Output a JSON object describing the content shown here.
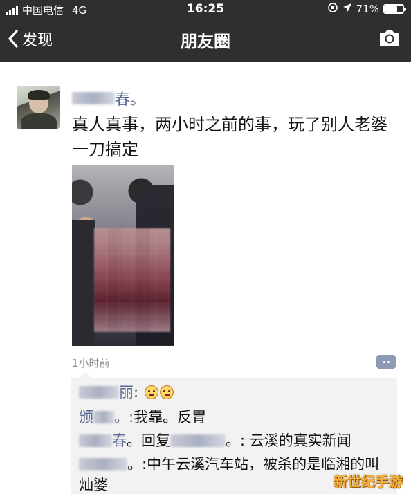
{
  "status_bar": {
    "carrier": "中国电信",
    "network": "4G",
    "time": "16:25",
    "battery": "71%",
    "battery_level": 0.71
  },
  "nav": {
    "back_label": "发现",
    "title": "朋友圈"
  },
  "post": {
    "nickname_visible": "春。",
    "text": "真人真事，两小时之前的事，玩了别人老婆一刀搞定",
    "time_ago": "1小时前"
  },
  "comments": [
    {
      "author_visible": "丽",
      "sep": ":",
      "text": ""
    },
    {
      "author_visible": "颁",
      "sep": "。:",
      "text": "我靠。反胃"
    },
    {
      "author_visible": "春",
      "sep": "。回复",
      "reply_to_visible": "",
      "text": "。: 云溪的真实新闻"
    },
    {
      "author_visible": "",
      "sep": "。:",
      "text": "中午云溪汽车站，被杀的是临湘的叫灿婆"
    }
  ],
  "watermark": "新世纪手游"
}
